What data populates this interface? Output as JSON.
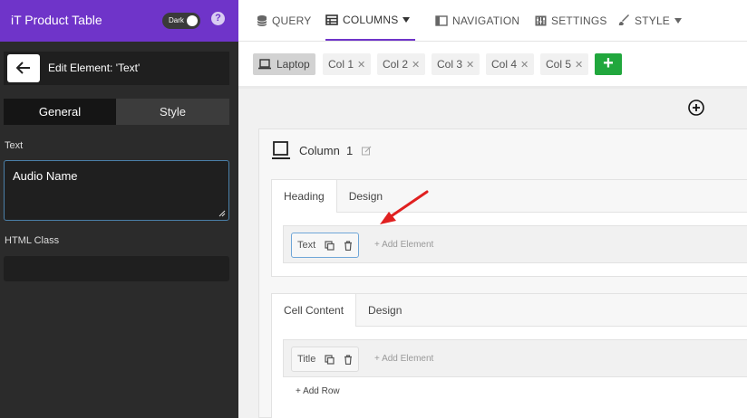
{
  "sidebar": {
    "app_title": "iT Product Table",
    "dark_label": "Dark",
    "help_label": "?",
    "edit_title": "Edit Element: 'Text'",
    "tabs": [
      {
        "label": "General"
      },
      {
        "label": "Style"
      }
    ],
    "text_label": "Text",
    "text_value": "Audio Name",
    "html_class_label": "HTML Class",
    "html_class_value": ""
  },
  "nav": {
    "items": [
      {
        "label": "QUERY",
        "icon": "database-icon"
      },
      {
        "label": "COLUMNS",
        "icon": "table-icon",
        "active": true
      },
      {
        "label": "NAVIGATION",
        "icon": "navigation-icon"
      },
      {
        "label": "SETTINGS",
        "icon": "settings-icon"
      },
      {
        "label": "STYLE",
        "icon": "brush-icon"
      }
    ]
  },
  "toolbar": {
    "device": "Laptop",
    "columns": [
      "Col 1",
      "Col 2",
      "Col 3",
      "Col 4",
      "Col 5"
    ],
    "close_glyph": "✕",
    "add_glyph": "+"
  },
  "canvas": {
    "column_title": "Column",
    "column_number": "1",
    "heading_block": {
      "tabs": [
        "Heading",
        "Design"
      ],
      "element": "Text",
      "add_element": "+ Add Element"
    },
    "cell_block": {
      "tabs": [
        "Cell Content",
        "Design"
      ],
      "element": "Title",
      "add_element": "+ Add Element",
      "add_row": "+ Add Row"
    }
  },
  "colors": {
    "accent": "#6f34c9",
    "add_button": "#21a73d",
    "arrow": "#e02020"
  }
}
